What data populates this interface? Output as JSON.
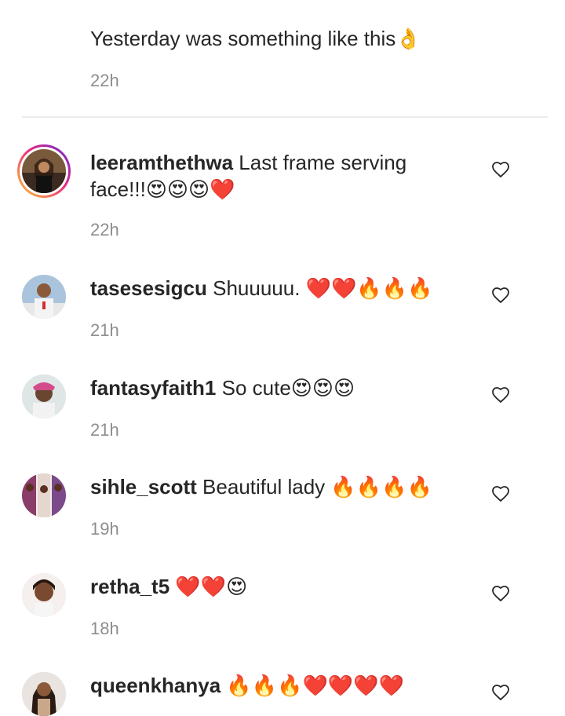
{
  "top": {
    "caption": "Yesterday was something like this👌",
    "time": "22h"
  },
  "comments": [
    {
      "username": "leeramthethwa",
      "text": " Last frame serving face!!!😍😍😍❤️",
      "time": "22h"
    },
    {
      "username": "tasesesigcu",
      "text": " Shuuuuu. ❤️❤️🔥🔥🔥",
      "time": "21h"
    },
    {
      "username": "fantasyfaith1",
      "text": " So cute😍😍😍",
      "time": "21h"
    },
    {
      "username": "sihle_scott",
      "text": " Beautiful lady 🔥🔥🔥🔥",
      "time": "19h"
    },
    {
      "username": "retha_t5",
      "text": " ❤️❤️😍",
      "time": "18h"
    },
    {
      "username": "queenkhanya",
      "text": " 🔥🔥🔥❤️❤️❤️❤️",
      "time": ""
    }
  ],
  "icons": {
    "like": "heart-outline-icon"
  },
  "colors": {
    "text": "#262626",
    "secondary": "#8e8e8e",
    "divider": "#ececec"
  }
}
